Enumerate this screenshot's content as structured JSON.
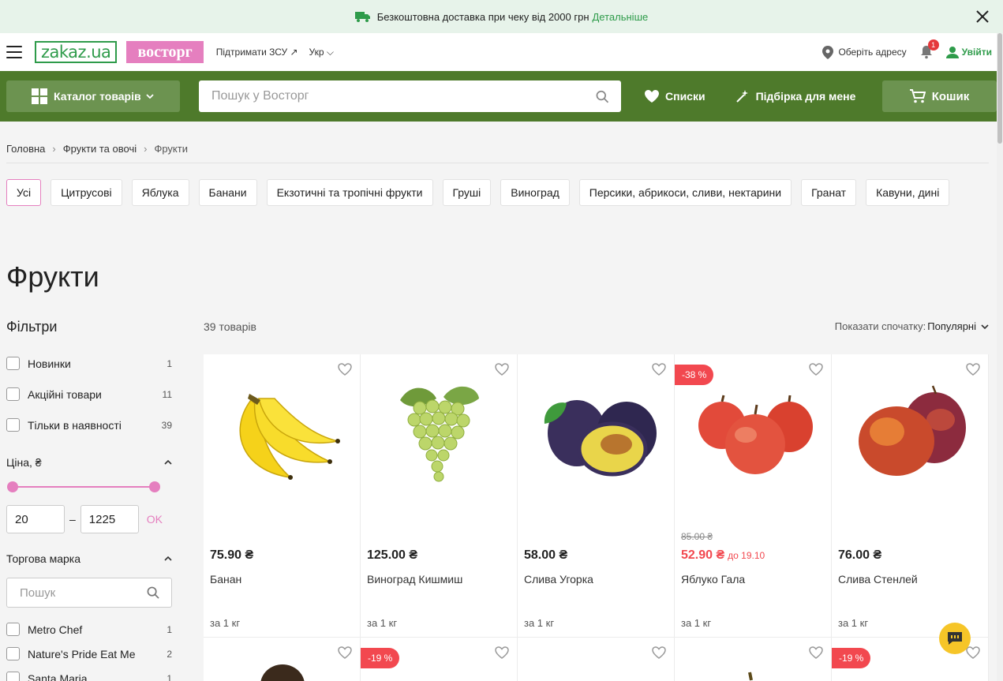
{
  "promo": {
    "text": "Безкоштовна доставка при чеку від 2000 грн",
    "link": "Детальніше"
  },
  "header": {
    "logo_zakaz": "zakaz.ua",
    "logo_store": "восторг",
    "support": "Підтримати ЗСУ ↗",
    "lang": "Укр",
    "address": "Оберіть адресу",
    "notifications": "1",
    "login": "Увійти"
  },
  "nav": {
    "catalog": "Каталог товарів",
    "search_placeholder": "Пошук у Восторг",
    "lists": "Списки",
    "picks": "Підбірка для мене",
    "cart": "Кошик"
  },
  "breadcrumb": [
    "Головна",
    "Фрукти та овочі",
    "Фрукти"
  ],
  "categories": [
    "Усі",
    "Цитрусові",
    "Яблука",
    "Банани",
    "Екзотичні та тропічні фрукти",
    "Груші",
    "Виноград",
    "Персики, абрикоси, сливи, нектарини",
    "Гранат",
    "Кавуни, дині"
  ],
  "page_title": "Фрукти",
  "filters": {
    "title": "Фільтри",
    "checks": [
      {
        "label": "Новинки",
        "count": "1"
      },
      {
        "label": "Акційні товари",
        "count": "11"
      },
      {
        "label": "Тільки в наявності",
        "count": "39"
      }
    ],
    "price_label": "Ціна, ₴",
    "price_min": "20",
    "price_max": "1225",
    "ok": "OK",
    "brand_label": "Торгова марка",
    "brand_search_placeholder": "Пошук",
    "brands": [
      {
        "label": "Metro Chef",
        "count": "1"
      },
      {
        "label": "Nature's Pride Eat Me",
        "count": "2"
      },
      {
        "label": "Santa Maria",
        "count": "1"
      }
    ]
  },
  "results": {
    "count": "39 товарів",
    "sort_label": "Показати спочатку:",
    "sort_value": "Популярні"
  },
  "products": [
    {
      "name": "Банан",
      "price": "75.90 ₴",
      "old_price": "",
      "until": "",
      "discount": "",
      "unit": "за 1 кг",
      "image": "banana"
    },
    {
      "name": "Виноград Кишмиш",
      "price": "125.00 ₴",
      "old_price": "",
      "until": "",
      "discount": "",
      "unit": "за 1 кг",
      "image": "grapes"
    },
    {
      "name": "Слива Угорка",
      "price": "58.00 ₴",
      "old_price": "",
      "until": "",
      "discount": "",
      "unit": "за 1 кг",
      "image": "plum"
    },
    {
      "name": "Яблуко Гала",
      "price": "52.90 ₴",
      "old_price": "85.00 ₴",
      "until": "до 19.10",
      "discount": "-38 %",
      "unit": "за 1 кг",
      "image": "apples"
    },
    {
      "name": "Слива Стенлей",
      "price": "76.00 ₴",
      "old_price": "",
      "until": "",
      "discount": "",
      "unit": "за 1 кг",
      "image": "plum-red"
    }
  ],
  "row2_discounts": [
    "",
    "-19 %",
    "",
    "",
    "-19 %"
  ],
  "colors": {
    "brand_green": "#4e7a2b",
    "accent_pink": "#e57fbf",
    "sale_red": "#f2484f"
  }
}
